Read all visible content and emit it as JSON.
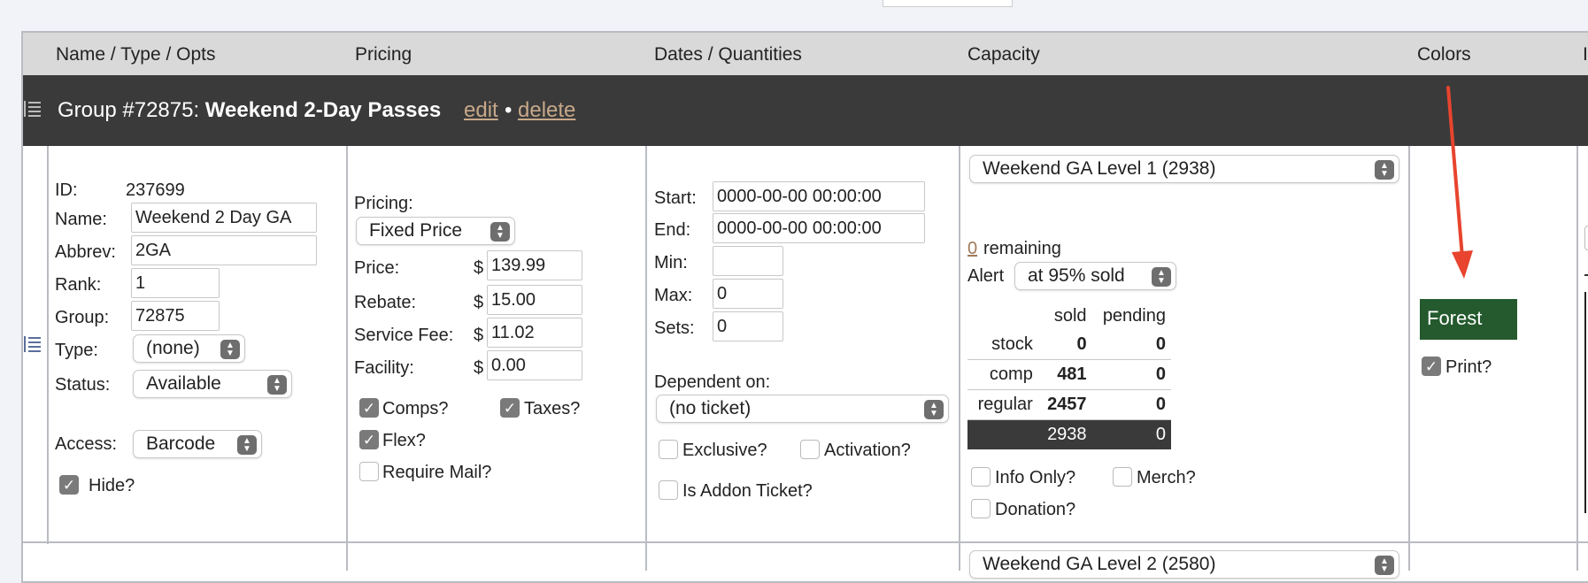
{
  "headers": [
    "Name / Type / Opts",
    "Pricing",
    "Dates / Quantities",
    "Capacity",
    "Colors",
    "I"
  ],
  "group": {
    "prefix": "Group #72875: ",
    "name": "Weekend 2-Day Passes",
    "edit": "edit",
    "sep": "•",
    "delete": "delete"
  },
  "ticket": {
    "id_label": "ID:",
    "id_value": "237699",
    "name_label": "Name:",
    "name_value": "Weekend 2 Day GA",
    "abbrev_label": "Abbrev:",
    "abbrev_value": "2GA",
    "rank_label": "Rank:",
    "rank_value": "1",
    "group_label": "Group:",
    "group_value": "72875",
    "type_label": "Type:",
    "type_value": "(none)",
    "status_label": "Status:",
    "status_value": "Available",
    "access_label": "Access:",
    "access_value": "Barcode",
    "hide_label": "Hide?",
    "hide_checked": true
  },
  "pricing": {
    "pricing_label": "Pricing:",
    "pricing_value": "Fixed Price",
    "price_label": "Price:",
    "price_value": "139.99",
    "rebate_label": "Rebate:",
    "rebate_value": "15.00",
    "fee_label": "Service Fee:",
    "fee_value": "11.02",
    "facility_label": "Facility:",
    "facility_value": "0.00",
    "currency": "$",
    "comps_label": "Comps?",
    "taxes_label": "Taxes?",
    "flex_label": "Flex?",
    "mail_label": "Require Mail?"
  },
  "dates": {
    "start_label": "Start:",
    "start_value": "0000-00-00 00:00:00",
    "end_label": "End:",
    "end_value": "0000-00-00 00:00:00",
    "min_label": "Min:",
    "min_value": "",
    "max_label": "Max:",
    "max_value": "0",
    "sets_label": "Sets:",
    "sets_value": "0",
    "dependent_label": "Dependent on:",
    "dependent_value": "(no ticket)",
    "exclusive_label": "Exclusive?",
    "activation_label": "Activation?",
    "addon_label": "Is Addon Ticket?"
  },
  "capacity": {
    "level_value": "Weekend GA Level 1 (2938)",
    "remaining_count": "0",
    "remaining_label": "remaining",
    "alert_label": "Alert",
    "alert_value": "at 95% sold",
    "col_sold": "sold",
    "col_pending": "pending",
    "rows": [
      {
        "label": "stock",
        "sold": "0",
        "pending": "0"
      },
      {
        "label": "comp",
        "sold": "481",
        "pending": "0"
      },
      {
        "label": "regular",
        "sold": "2457",
        "pending": "0"
      }
    ],
    "total_sold": "2938",
    "total_pending": "0",
    "info_label": "Info Only?",
    "merch_label": "Merch?",
    "donation_label": "Donation?",
    "next_level_value": "Weekend GA Level 2 (2580)"
  },
  "colors": {
    "color_name": "Forest",
    "color_hex": "#245a2e",
    "print_label": "Print?",
    "arrow_color": "#e8442e"
  }
}
